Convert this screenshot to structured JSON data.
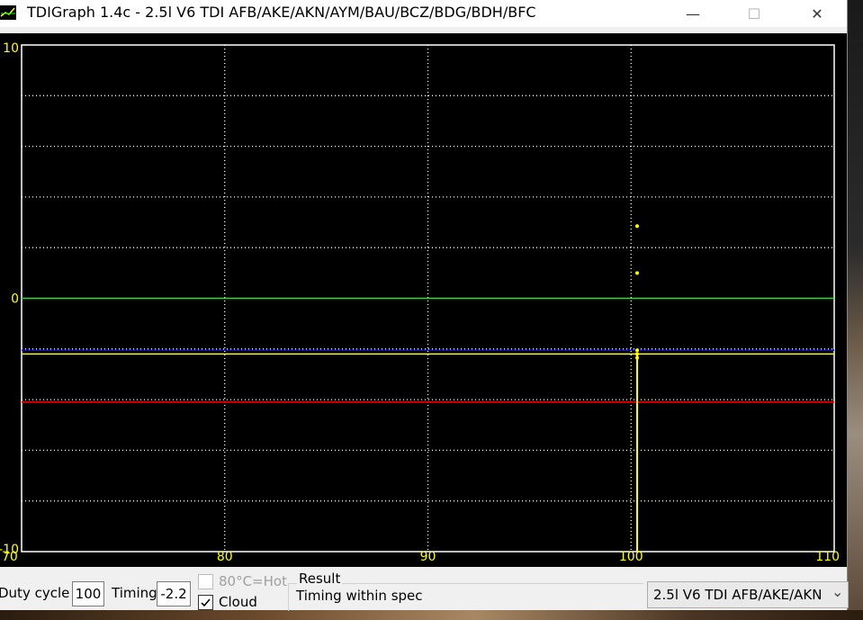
{
  "window": {
    "title": "TDIGraph 1.4c - 2.5l V6 TDI AFB/AKE/AKN/AYM/BAU/BCZ/BDG/BDH/BFC",
    "minimize_glyph": "—",
    "maximize_glyph": "☐",
    "close_glyph": "✕"
  },
  "chart_data": {
    "type": "scatter",
    "xlim": [
      70,
      110
    ],
    "ylim": [
      -10,
      10
    ],
    "x_ticks": [
      "70",
      "80",
      "90",
      "100",
      "110"
    ],
    "y_ticks": [
      "10",
      "0",
      "-10"
    ],
    "grid": true,
    "background": "#000000",
    "reference_lines": [
      {
        "y": 0,
        "color": "#00ff00"
      },
      {
        "y": -2.05,
        "color": "#0000ff"
      },
      {
        "y": -2.2,
        "color": "#ffff00"
      },
      {
        "y": -4.1,
        "color": "#ff0000"
      }
    ],
    "series": [
      {
        "color": "#ffff00",
        "points": [
          {
            "x": 100.3,
            "y": 2.85
          },
          {
            "x": 100.3,
            "y": 1.0
          },
          {
            "x": 100.3,
            "y": -2.05
          },
          {
            "x": 100.3,
            "y": -2.2
          },
          {
            "x": 100.3,
            "y": -2.35
          }
        ]
      }
    ],
    "marker": {
      "x": 100.3,
      "from": -2.2,
      "to": -10
    }
  },
  "status": {
    "duty_label": "Duty cycle",
    "duty_value": "100",
    "timing_label": "Timing",
    "timing_value": "-2.2",
    "hot_label": "80°C=Hot",
    "cloud_label": "Cloud",
    "cloud_checked": true,
    "result_label": "Result",
    "result_value": "Timing within spec",
    "engine_select": "2.5l V6 TDI AFB/AKE/AKN",
    "dropdown_glyph": "⌄"
  }
}
